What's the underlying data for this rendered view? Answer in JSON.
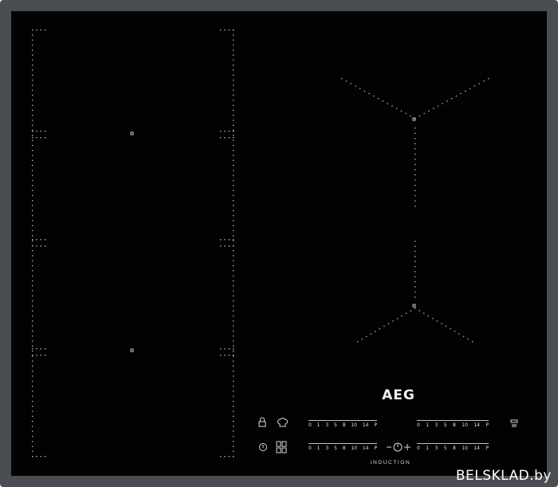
{
  "brand": "AEG",
  "label": "INDUCTION",
  "watermark": "BELSKLAD.by",
  "colors": {
    "glass": "#020203",
    "frame": "#4a4d52",
    "dots": "#c8c8c8"
  },
  "sliders": {
    "left_top": [
      "0",
      "1",
      "3",
      "5",
      "8",
      "10",
      "14",
      "P"
    ],
    "right_top": [
      "0",
      "1",
      "3",
      "5",
      "8",
      "10",
      "14",
      "P"
    ],
    "left_bottom": [
      "0",
      "1",
      "3",
      "5",
      "8",
      "10",
      "14",
      "P"
    ],
    "right_bottom": [
      "0",
      "1",
      "3",
      "5",
      "8",
      "10",
      "14",
      "P"
    ]
  },
  "icons": [
    "lock-icon",
    "chef-hat-icon",
    "power-icon",
    "bridge-zones-icon",
    "timer-minus-icon",
    "timer-plus-icon",
    "hob-to-hood-icon"
  ]
}
